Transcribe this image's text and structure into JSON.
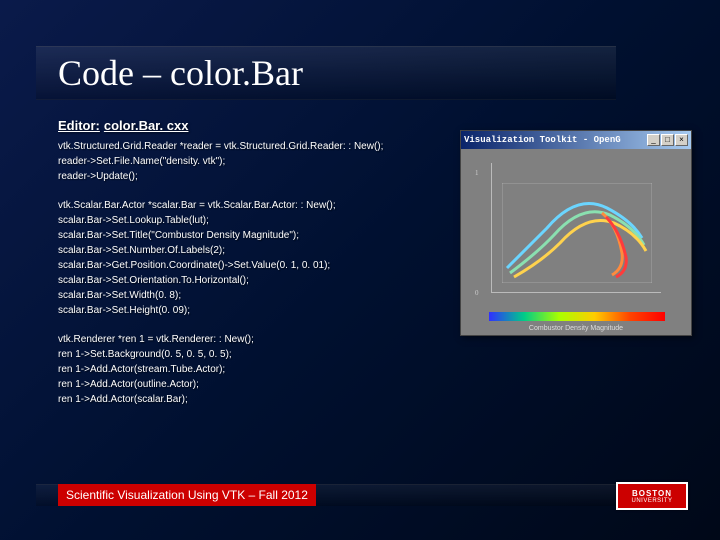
{
  "title": "Code – color.Bar",
  "editor": {
    "label": "Editor:",
    "file": "color.Bar. cxx"
  },
  "code_groups": [
    [
      "vtk.Structured.Grid.Reader *reader = vtk.Structured.Grid.Reader: : New();",
      "reader->Set.File.Name(\"density. vtk\");",
      "reader->Update();"
    ],
    [
      "vtk.Scalar.Bar.Actor *scalar.Bar = vtk.Scalar.Bar.Actor: : New();",
      "scalar.Bar->Set.Lookup.Table(lut);",
      "scalar.Bar->Set.Title(\"Combustor Density Magnitude\");",
      "scalar.Bar->Set.Number.Of.Labels(2);",
      "scalar.Bar->Get.Position.Coordinate()->Set.Value(0. 1, 0. 01);",
      "scalar.Bar->Set.Orientation.To.Horizontal();",
      "scalar.Bar->Set.Width(0. 8);",
      "scalar.Bar->Set.Height(0. 09);"
    ],
    [
      "vtk.Renderer *ren 1 = vtk.Renderer: : New();",
      "ren 1->Set.Background(0. 5, 0. 5, 0. 5);",
      "ren 1->Add.Actor(stream.Tube.Actor);",
      "ren 1->Add.Actor(outline.Actor);",
      "ren 1->Add.Actor(scalar.Bar);"
    ]
  ],
  "viz": {
    "title": "Visualization Toolkit - OpenG",
    "colorbar_label": "Combustor Density Magnitude",
    "min_btn": "_",
    "max_btn": "□",
    "close_btn": "×"
  },
  "footer": "Scientific Visualization Using VTK – Fall 2012",
  "logo": {
    "top": "BOSTON",
    "bottom": "UNIVERSITY"
  }
}
